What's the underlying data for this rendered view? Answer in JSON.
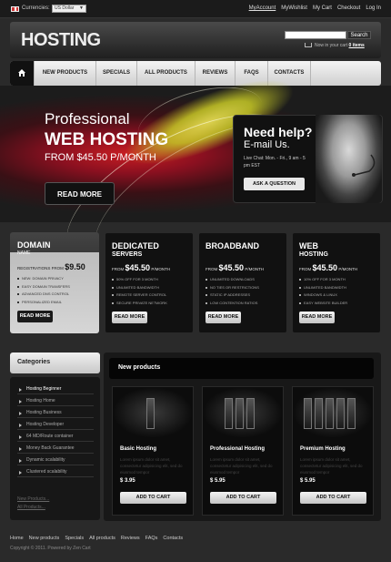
{
  "topbar": {
    "currencies_label": "Currencies:",
    "currency_value": "US Dollar",
    "links": [
      "MyAccount",
      "MyWishlist",
      "My Cart",
      "Checkout",
      "Log In"
    ]
  },
  "header": {
    "logo": "HOSTING",
    "search_button": "Search",
    "cart_text": "Now in your cart",
    "cart_items": "0 items"
  },
  "nav": {
    "items": [
      "NEW PRODUCTS",
      "SPECIALS",
      "ALL PRODUCTS",
      "REVIEWS",
      "FAQS",
      "CONTACTS"
    ]
  },
  "hero": {
    "line1": "Professional",
    "line2_a": "WEB",
    "line2_b": "HOSTING",
    "line3": "FROM $45.50 P/MONTH",
    "button": "READ MORE"
  },
  "help": {
    "title": "Need help?",
    "subtitle": "E-mail Us.",
    "info": "Live Chat: Mon. - Fri., 9 am - 5 pm EST",
    "button": "ASK A QUESTION"
  },
  "plans": [
    {
      "title": "DOMAIN",
      "subtitle": "NAME",
      "price_prefix": "REGISTRATIONS FROM",
      "price": "$9.50",
      "price_suffix": "",
      "features": [
        "NEW: DOMAIN PRIVACY",
        "EASY DOMAIN TRANSFERS",
        "ADVANCED DNS CONTROL",
        "PERSONALIZED EMAIL"
      ],
      "button": "READ MORE"
    },
    {
      "title": "DEDICATED",
      "subtitle": "SERVERS",
      "price_prefix": "FROM",
      "price": "$45.50",
      "price_suffix": "P/MONTH",
      "features": [
        "50% OFF FOR 3 MONTH",
        "UNLIMITED BANDWIDTH",
        "REMOTE SERVER CONTROL",
        "SECURE PRIVATE NETWORK"
      ],
      "button": "READ MORE"
    },
    {
      "title": "BROADBAND",
      "subtitle": "",
      "price_prefix": "FROM",
      "price": "$45.50",
      "price_suffix": "P/MONTH",
      "features": [
        "UNLIMITED DOWNLOADS",
        "NO TIES OR RESTRICTIONS",
        "STATIC IP ADDRESSES",
        "LOW CONTENTION RATIOS"
      ],
      "button": "READ MORE"
    },
    {
      "title": "WEB",
      "subtitle": "HOSTING",
      "price_prefix": "FROM",
      "price": "$45.50",
      "price_suffix": "P/MONTH",
      "features": [
        "10% OFF FOR 3 MONTH",
        "UNLIMITED BANDWIDTH",
        "WINDOWS & LINUX",
        "EASY WEBSITE BUILDER"
      ],
      "button": "READ MORE"
    }
  ],
  "categories": {
    "title": "Categories",
    "items": [
      "Hosting Beginner",
      "Hosting Home",
      "Hosting Business",
      "Hosting Developer",
      "64 MD/Route container",
      "Money Back Guarantee",
      "Dynamic scalability",
      "Clustered scalability"
    ],
    "links": [
      "New Products...",
      "All Products..."
    ]
  },
  "new_products": {
    "title": "New products",
    "items": [
      {
        "name": "Basic Hosting",
        "desc": "Lorem ipsum dolor sit amet, consectetur adipisicing elit, sed do eiusmod tempor",
        "price": "$ 3.95",
        "button": "ADD TO CART"
      },
      {
        "name": "Professional Hosting",
        "desc": "Lorem ipsum dolor sit amet, consectetur adipisicing elit, sed do eiusmod tempor",
        "price": "$ 5.95",
        "button": "ADD TO CART"
      },
      {
        "name": "Premium Hosting",
        "desc": "Lorem ipsum dolor sit amet, consectetur adipisicing elit, sed do eiusmod tempor",
        "price": "$ 5.95",
        "button": "ADD TO CART"
      }
    ]
  },
  "footer": {
    "links": [
      "Home",
      "New products",
      "Specials",
      "All products",
      "Reviews",
      "FAQs",
      "Contacts"
    ],
    "copyright": "Copyright © 2011. Powered by Zen Cart"
  }
}
